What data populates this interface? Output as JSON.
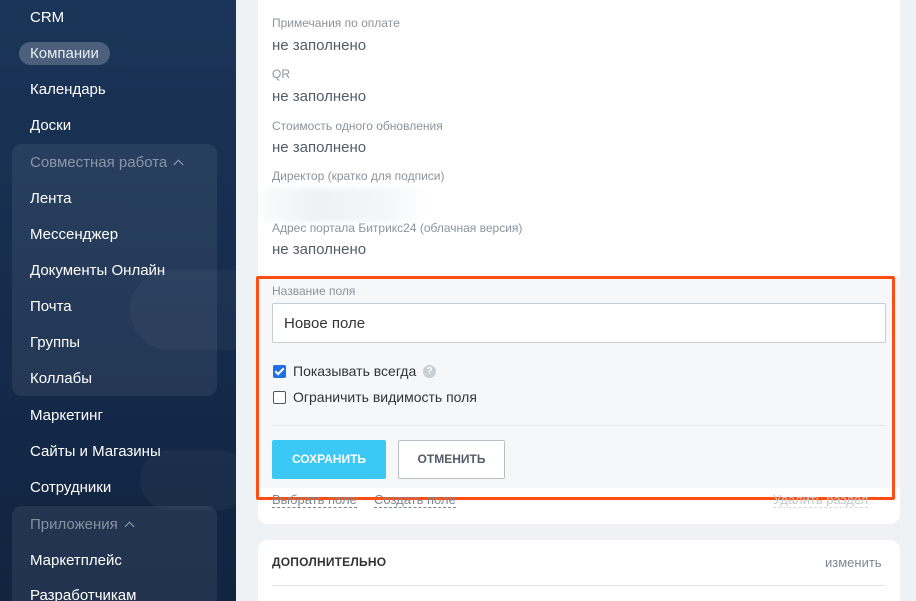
{
  "sidebar": {
    "items": [
      {
        "label": "CRM"
      },
      {
        "label": "Компании"
      },
      {
        "label": "Календарь"
      },
      {
        "label": "Доски"
      },
      {
        "label": "Лента"
      },
      {
        "label": "Мессенджер"
      },
      {
        "label": "Документы Онлайн"
      },
      {
        "label": "Почта"
      },
      {
        "label": "Группы"
      },
      {
        "label": "Коллабы"
      },
      {
        "label": "Маркетинг"
      },
      {
        "label": "Сайты и Магазины"
      },
      {
        "label": "Сотрудники"
      },
      {
        "label": "Маркетплейс"
      },
      {
        "label": "Разработчикам"
      }
    ],
    "groups": [
      {
        "label": "Совместная работа"
      },
      {
        "label": "Приложения"
      }
    ]
  },
  "fields": [
    {
      "label": "Примечания по оплате",
      "value": "не заполнено"
    },
    {
      "label": "QR",
      "value": "не заполнено"
    },
    {
      "label": "Стоимость одного обновления",
      "value": "не заполнено"
    },
    {
      "label": "Директор (кратко для подписи)",
      "value": ""
    },
    {
      "label": "Адрес портала Битрикс24 (облачная версия)",
      "value": "не заполнено"
    }
  ],
  "editor": {
    "field_name_label": "Название поля",
    "field_name_value": "Новое поле",
    "show_always_label": "Показывать всегда",
    "show_always_checked": true,
    "restrict_visibility_label": "Ограничить видимость поля",
    "restrict_visibility_checked": false,
    "help_glyph": "?",
    "save_label": "СОХРАНИТЬ",
    "cancel_label": "ОТМЕНИТЬ"
  },
  "links": {
    "select_field": "Выбрать поле",
    "create_field": "Создать поле",
    "delete_section": "Удалить раздел"
  },
  "additional": {
    "title": "ДОПОЛНИТЕЛЬНО",
    "edit_label": "изменить"
  },
  "colors": {
    "highlight": "#ff4e12",
    "save_button": "#3bc8f5",
    "checkbox": "#1f6fe5",
    "sidebar": "#1b3558"
  }
}
